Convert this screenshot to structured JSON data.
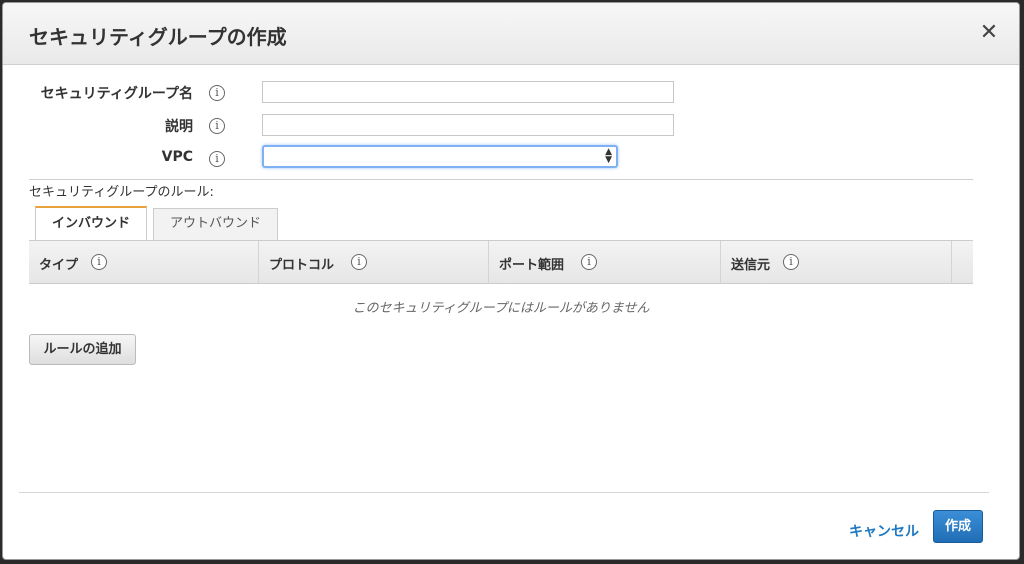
{
  "dialog": {
    "title": "セキュリティグループの作成",
    "close_icon": "close-icon"
  },
  "form": {
    "name_label": "セキュリティグループ名",
    "name_value": "",
    "description_label": "説明",
    "description_value": "",
    "vpc_label": "VPC",
    "vpc_selected": "",
    "info_icon": "info-icon"
  },
  "rules": {
    "section_title": "セキュリティグループのルール:",
    "tabs": [
      {
        "label": "インバウンド",
        "active": true
      },
      {
        "label": "アウトバウンド",
        "active": false
      }
    ],
    "columns": [
      {
        "label": "タイプ"
      },
      {
        "label": "プロトコル"
      },
      {
        "label": "ポート範囲"
      },
      {
        "label": "送信元"
      }
    ],
    "empty_message": "このセキュリティグループにはルールがありません",
    "add_rule_label": "ルールの追加"
  },
  "footer": {
    "cancel_label": "キャンセル",
    "create_label": "作成"
  },
  "colors": {
    "accent_blue": "#1f78c1",
    "tab_active_border": "#e8a23c",
    "focus_ring": "#7eb0f2"
  }
}
